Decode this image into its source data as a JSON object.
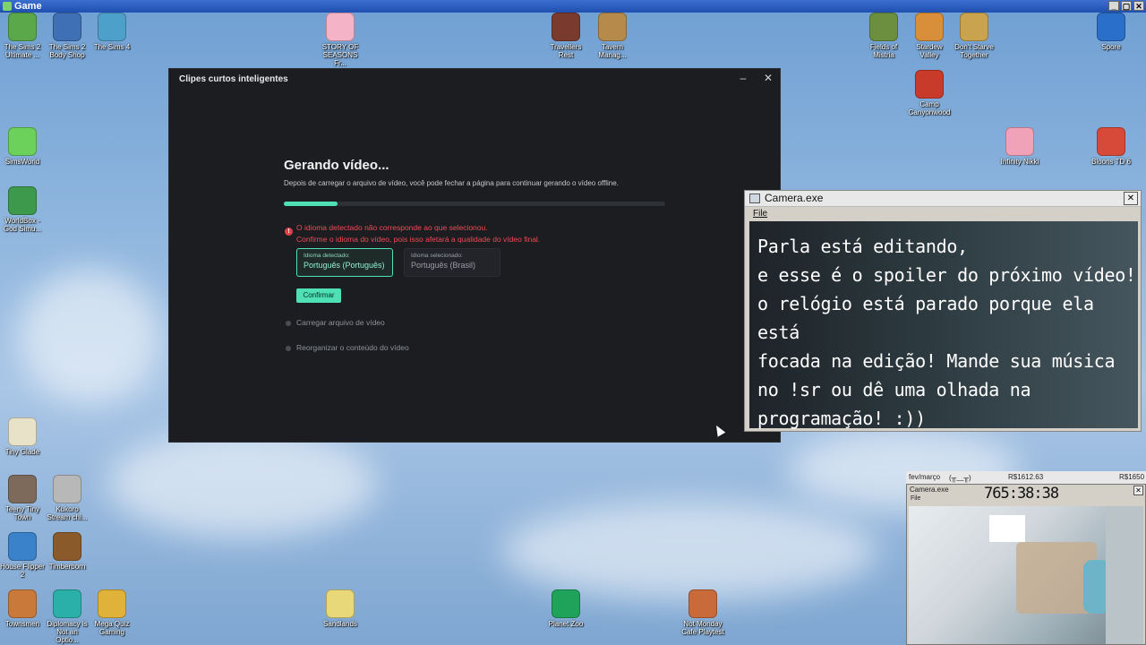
{
  "outer_window": {
    "title": "Game",
    "controls": [
      "_",
      "▢",
      "✕"
    ]
  },
  "desktop_icons": [
    {
      "label": "The Sims 2 Ultimate ...",
      "color": "#5aa84a"
    },
    {
      "label": "The Sims 2 Body Shop",
      "color": "#3f6fb5"
    },
    {
      "label": "The Sims 4",
      "color": "#4ca0c9"
    },
    {
      "label": "STORY OF SEASONS Fr...",
      "color": "#f4b3c6"
    },
    {
      "label": "Travellers Rest",
      "color": "#7a3b2e"
    },
    {
      "label": "Tavern Manag...",
      "color": "#b58a4a"
    },
    {
      "label": "Fields of Mistria",
      "color": "#6b8f3e"
    },
    {
      "label": "Stardew Valley",
      "color": "#d98f3a"
    },
    {
      "label": "Don't Starve Together",
      "color": "#c9a34d"
    },
    {
      "label": "Spore",
      "color": "#2a6fc9"
    },
    {
      "label": "Camp Canyonwood",
      "color": "#c83a2a"
    },
    {
      "label": "SimsWorld",
      "color": "#6bd15a"
    },
    {
      "label": "Infinity Nikki",
      "color": "#f0a3b8"
    },
    {
      "label": "Bloons TD 6",
      "color": "#d74a3a"
    },
    {
      "label": "WorldBox - God Simu...",
      "color": "#3d9a4c"
    },
    {
      "label": "Tiny Glade",
      "color": "#e8e2c8"
    },
    {
      "label": "Teeny Tiny Town",
      "color": "#7d6a5a"
    },
    {
      "label": "Kukoro Stream chi...",
      "color": "#b8b8b8"
    },
    {
      "label": "House Flipper 2",
      "color": "#3a82c9"
    },
    {
      "label": "Timberborn",
      "color": "#8a5a2a"
    },
    {
      "label": "Townsmen",
      "color": "#c97a3a"
    },
    {
      "label": "Diplomacy is Not an Optio...",
      "color": "#2ab0a8"
    },
    {
      "label": "Mega Quiz Gaming",
      "color": "#e0b23a"
    },
    {
      "label": "Sandlands",
      "color": "#e8d87a"
    },
    {
      "label": "Planet Zoo",
      "color": "#1fa35a"
    },
    {
      "label": "Not Monday Cafe Playtest",
      "color": "#c96a3a"
    }
  ],
  "app": {
    "title": "Clipes curtos inteligentes",
    "minimize": "–",
    "close": "✕",
    "heading": "Gerando vídeo...",
    "subtext": "Depois de carregar o arquivo de vídeo, você pode fechar a página para continuar gerando o vídeo offline.",
    "progress_percent": 14,
    "warning_icon": "!",
    "warning_line1": "O idioma detectado não corresponde ao que selecionou.",
    "warning_line2": "Confirme o idioma do vídeo, pois isso afetará a qualidade do vídeo final.",
    "detected_label": "Idioma detectado:",
    "detected_value": "Português (Português)",
    "selected_label": "Idioma selecionado:",
    "selected_value": "Português (Brasil)",
    "confirm_label": "Confirmar",
    "step1": "Carregar arquivo de vídeo",
    "step2": "Reorganizar o conteúdo do vídeo"
  },
  "camera_window": {
    "title": "Camera.exe",
    "close": "✕",
    "menu_file": "File",
    "lines": [
      "Parla está editando,",
      "e esse é o spoiler do próximo vídeo!",
      "o relógio está parado porque ela está",
      "focada na edição! Mande sua música",
      "no !sr ou dê uma olhada na",
      "programação!  :))"
    ]
  },
  "stream_widget": {
    "date": "fev/março",
    "emote": "(╥﹏╥)",
    "amount1": "R$1612.63",
    "amount2": "R$1650",
    "cam_title": "Camera.exe",
    "file": "File",
    "clock": "765:38:38",
    "close": "✕"
  }
}
